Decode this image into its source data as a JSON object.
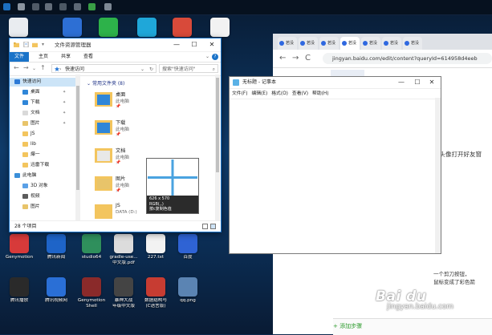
{
  "topbar": {
    "icons": [
      {
        "name": "taskbar-app-icon-1",
        "color": "#1f7ad1"
      },
      {
        "name": "taskbar-app-icon-2",
        "color": "#9aa3ad"
      },
      {
        "name": "taskbar-app-icon-3",
        "color": "#59636e"
      },
      {
        "name": "taskbar-app-icon-4",
        "color": "#6f7984"
      },
      {
        "name": "taskbar-app-icon-5",
        "color": "#54606b"
      },
      {
        "name": "taskbar-app-icon-6",
        "color": "#67727e"
      },
      {
        "name": "taskbar-app-icon-7",
        "color": "#3fae49"
      },
      {
        "name": "taskbar-app-icon-8",
        "color": "#8b96a1"
      }
    ]
  },
  "desktop": {
    "icons_top": [
      {
        "label": "",
        "color": "#e9ecf0"
      },
      {
        "label": "",
        "color": "#2d6fd4"
      },
      {
        "label": "",
        "color": "#2db24a"
      },
      {
        "label": "",
        "color": "#1fa7d9"
      },
      {
        "label": "",
        "color": "#d84a3a"
      },
      {
        "label": "",
        "color": "#f2f2f2"
      }
    ],
    "icons_bottom_row1": [
      {
        "label": "Genymotion",
        "color": "#d73a3a"
      },
      {
        "label": "腾讯新闻",
        "color": "#1e64c8"
      },
      {
        "label": "studio64",
        "color": "#2f8f5c"
      },
      {
        "label": "gradle-use...",
        "color": "#dcdcdc"
      },
      {
        "label": "227.txt",
        "color": "#f2f2f2"
      },
      {
        "label": "百度",
        "color": "#2f63d4"
      }
    ],
    "icons_bottom_row1_sub": [
      "",
      "",
      "",
      "中文版.pdf",
      "",
      ""
    ],
    "icons_bottom_row2": [
      {
        "label": "腾讯播放",
        "color": "#2a2a2a"
      },
      {
        "label": "腾讯视频网",
        "color": "#2a6fd6"
      },
      {
        "label": "Genymotion",
        "color": "#8a2a2a"
      },
      {
        "label": "暴神大战",
        "color": "#444444"
      },
      {
        "label": "数据结构与",
        "color": "#c73c32"
      },
      {
        "label": "qq.png",
        "color": "#5b84b3"
      }
    ],
    "icons_bottom_row2_sub": [
      "",
      "",
      "Shell",
      "年级中文版",
      "(C语言版)",
      ""
    ]
  },
  "browser": {
    "tabs": [
      "若没",
      "若没",
      "若没",
      "若没",
      "若没",
      "若没",
      "若没"
    ],
    "nav": {
      "back": "←",
      "forward": "→",
      "reload": "C",
      "home": "⌂"
    },
    "url": "jingyan.baidu.com/edit/content?queryId=614958d4eeb",
    "text_partial_1": "友头像打开好友窗",
    "text_partial_2a": "一个剪刀按钮，",
    "text_partial_2b": "鼠标变成了彩色箭",
    "add_step": "+ 添加步骤",
    "watermark_logo": "Bai du",
    "watermark_sub": "jingyan.baidu.com"
  },
  "notepad": {
    "title": "无标题 - 记事本",
    "menu": [
      "文件(F)",
      "编辑(E)",
      "格式(O)",
      "查看(V)",
      "帮助(H)"
    ],
    "ctrl": {
      "min": "—",
      "max": "☐",
      "close": "✕"
    }
  },
  "explorer": {
    "title": "文件资源管理器",
    "ribbon_tabs": [
      "文件",
      "主页",
      "共享",
      "查看"
    ],
    "ctrl": {
      "min": "—",
      "max": "☐",
      "close": "✕"
    },
    "address": "快速访问",
    "search_placeholder": "搜索\"快速访问\"",
    "nav_items": [
      {
        "label": "快速访问",
        "indent": 0,
        "icon": "star-icon",
        "color": "#2d7ad6",
        "selected": true
      },
      {
        "label": "桌面",
        "indent": 1,
        "icon": "desktop-icon",
        "color": "#2f86d8",
        "pin": true
      },
      {
        "label": "下载",
        "indent": 1,
        "icon": "download-icon",
        "color": "#2f86d8",
        "pin": true
      },
      {
        "label": "文档",
        "indent": 1,
        "icon": "document-icon",
        "color": "#d9d9d9",
        "pin": true
      },
      {
        "label": "图片",
        "indent": 1,
        "icon": "pictures-icon",
        "color": "#e8c46a",
        "pin": true
      },
      {
        "label": "JS",
        "indent": 1,
        "icon": "folder-icon",
        "color": "#f3c55e"
      },
      {
        "label": "lib",
        "indent": 1,
        "icon": "folder-icon",
        "color": "#f3c55e"
      },
      {
        "label": "爆一",
        "indent": 1,
        "icon": "folder-icon",
        "color": "#f3c55e"
      },
      {
        "label": "迅雷下载",
        "indent": 1,
        "icon": "folder-icon",
        "color": "#f3c55e"
      },
      {
        "label": "此电脑",
        "indent": 0,
        "icon": "computer-icon",
        "color": "#3b8fd9"
      },
      {
        "label": "3D 对象",
        "indent": 1,
        "icon": "3d-objects-icon",
        "color": "#5aa0e6"
      },
      {
        "label": "视频",
        "indent": 1,
        "icon": "videos-icon",
        "color": "#5b5b5b"
      },
      {
        "label": "图片",
        "indent": 1,
        "icon": "pictures-icon",
        "color": "#e8c46a"
      }
    ],
    "group_header": "常用文件夹 (8)",
    "folders": [
      {
        "name": "桌面",
        "sub": "此电脑",
        "pin": "📌",
        "color": "#2f86d8",
        "kind": "desktop"
      },
      {
        "name": "下载",
        "sub": "此电脑",
        "pin": "📌",
        "color": "#2f86d8",
        "kind": "download"
      },
      {
        "name": "文档",
        "sub": "此电脑",
        "pin": "📌",
        "color": "#e8e8e8",
        "kind": "document"
      },
      {
        "name": "图片",
        "sub": "此电脑",
        "pin": "📌",
        "color": "#e8c46a",
        "kind": "pictures"
      },
      {
        "name": "JS",
        "sub": "DATA (D:)",
        "pin": "",
        "color": "#f3c55e",
        "kind": "folder"
      }
    ],
    "status": "28 个项目"
  },
  "tooltip": {
    "size": "626 x 570",
    "rgb": "RGB(,,)",
    "hint": "按c复制色值"
  },
  "colors": {
    "explorer_border": "#1a73c8",
    "file_tab": "#1a73c8",
    "crosshair": "#4aa3e0"
  }
}
